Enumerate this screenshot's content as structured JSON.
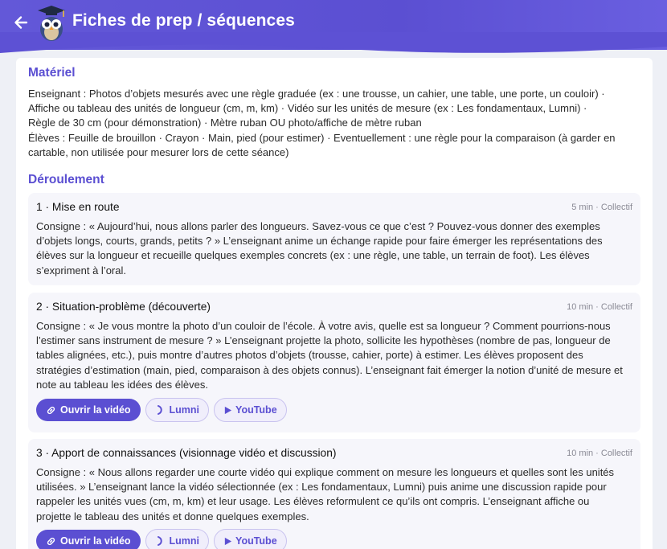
{
  "header": {
    "title": "Fiches de prep / séquences",
    "back_icon": "arrow-left-icon",
    "logo": "owl-graduate-logo"
  },
  "materiel": {
    "title": "Matériel",
    "lines": [
      "Enseignant : Photos d’objets mesurés avec une règle graduée (ex : une trousse, un cahier, une table, une porte, un couloir) ·",
      "Affiche ou tableau des unités de longueur (cm, m, km) · Vidéo sur les unités de mesure (ex : Les fondamentaux, Lumni) ·",
      "Règle de 30 cm (pour démonstration) · Mètre ruban OU photo/affiche de mètre ruban",
      "Élèves : Feuille de brouillon · Crayon · Main, pied (pour estimer) · Eventuellement : une règle pour la comparaison (à garder en",
      "cartable, non utilisée pour mesurer lors de cette séance)"
    ]
  },
  "deroulement": {
    "title": "Déroulement",
    "steps": [
      {
        "title": "1 · Mise en route",
        "meta": "5 min · Collectif",
        "lines": [
          "Consigne : « Aujourd’hui, nous allons parler des longueurs. Savez-vous ce que c’est ? Pouvez-vous donner des exemples",
          "d’objets longs, courts, grands, petits ? » L’enseignant anime un échange rapide pour faire émerger les représentations des",
          "élèves sur la longueur et recueille quelques exemples concrets (ex : une règle, une table, un terrain de foot). Les élèves",
          "s’expriment à l’oral."
        ]
      },
      {
        "title": "2 · Situation-problème (découverte)",
        "meta": "10 min · Collectif",
        "lines": [
          "Consigne : « Je vous montre la photo d’un couloir de l’école. À votre avis, quelle est sa longueur ? Comment pourrions-nous",
          "l’estimer sans instrument de mesure ? » L’enseignant projette la photo, sollicite les hypothèses (nombre de pas, longueur de",
          "tables alignées, etc.), puis montre d’autres photos d’objets (trousse, cahier, porte) à estimer. Les élèves proposent des",
          "stratégies d’estimation (main, pied, comparaison à des objets connus). L’enseignant fait émerger la notion d’unité de mesure et",
          "note au tableau les idées des élèves."
        ],
        "buttons": {
          "video": "Ouvrir la vidéo",
          "lumni": "Lumni",
          "youtube": "YouTube"
        }
      },
      {
        "title": "3 · Apport de connaissances (visionnage vidéo et discussion)",
        "meta": "10 min · Collectif",
        "lines": [
          "Consigne : « Nous allons regarder une courte vidéo qui explique comment on mesure les longueurs et quelles sont les unités",
          "utilisées. » L’enseignant lance la vidéo sélectionnée (ex : Les fondamentaux, Lumni) puis anime une discussion rapide pour",
          "rappeler les unités vues (cm, m, km) et leur usage. Les élèves reformulent ce qu’ils ont compris. L’enseignant affiche ou",
          "projette le tableau des unités et donne quelques exemples."
        ],
        "buttons": {
          "video": "Ouvrir la vidéo",
          "lumni": "Lumni",
          "youtube": "YouTube"
        }
      }
    ]
  },
  "colors": {
    "accent": "#5b4fd2",
    "background": "#eef0f6",
    "step_bg": "#f6f6fb"
  }
}
